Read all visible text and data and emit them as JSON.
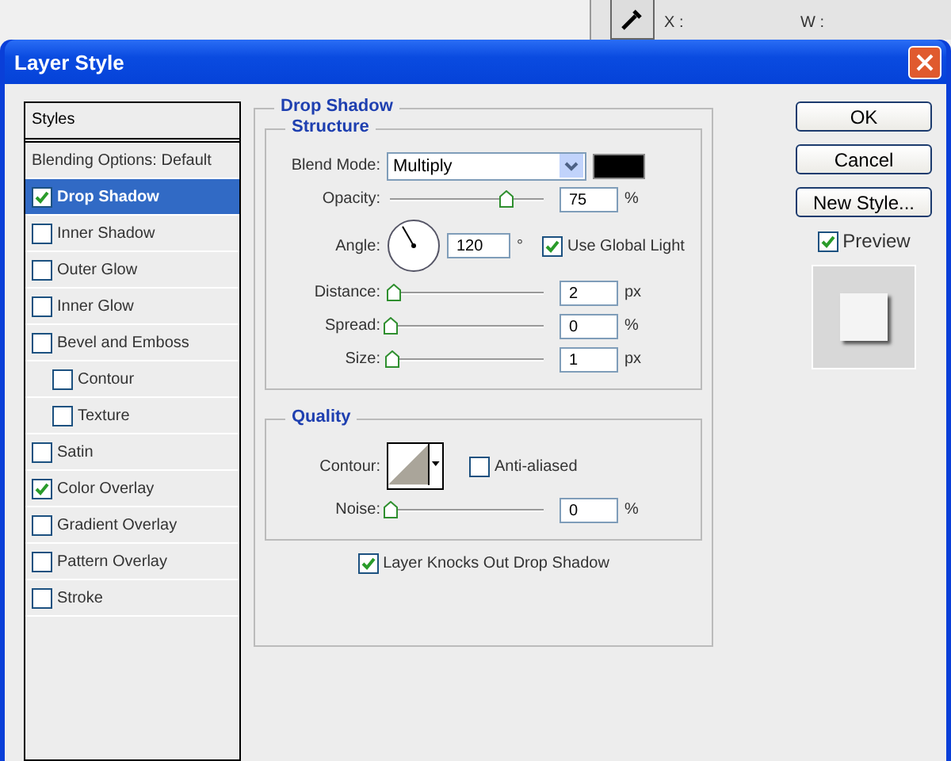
{
  "background": {
    "labels": [
      "X :",
      "W :"
    ]
  },
  "window": {
    "title": "Layer Style"
  },
  "styles_panel": {
    "header": "Styles",
    "items": [
      {
        "label": "Blending Options: Default",
        "kind": "plain",
        "selected": false
      },
      {
        "label": "Drop Shadow",
        "kind": "check",
        "checked": true,
        "selected": true
      },
      {
        "label": "Inner Shadow",
        "kind": "check",
        "checked": false,
        "selected": false
      },
      {
        "label": "Outer Glow",
        "kind": "check",
        "checked": false,
        "selected": false
      },
      {
        "label": "Inner Glow",
        "kind": "check",
        "checked": false,
        "selected": false
      },
      {
        "label": "Bevel and Emboss",
        "kind": "check",
        "checked": false,
        "selected": false,
        "children": [
          {
            "label": "Contour",
            "kind": "check",
            "checked": false,
            "selected": false
          },
          {
            "label": "Texture",
            "kind": "check",
            "checked": false,
            "selected": false
          }
        ]
      },
      {
        "label": "Satin",
        "kind": "check",
        "checked": false,
        "selected": false
      },
      {
        "label": "Color Overlay",
        "kind": "check",
        "checked": true,
        "selected": false
      },
      {
        "label": "Gradient Overlay",
        "kind": "check",
        "checked": false,
        "selected": false
      },
      {
        "label": "Pattern Overlay",
        "kind": "check",
        "checked": false,
        "selected": false
      },
      {
        "label": "Stroke",
        "kind": "check",
        "checked": false,
        "selected": false
      }
    ]
  },
  "drop_shadow": {
    "title": "Drop Shadow",
    "structure": {
      "title": "Structure",
      "blend_mode": {
        "label": "Blend Mode:",
        "value": "Multiply"
      },
      "rows": [
        {
          "kind": "slider",
          "label": "Opacity:",
          "value": "75",
          "unit": "%",
          "level": 0.75
        },
        {
          "kind": "angle",
          "label": "Angle:",
          "value": "120",
          "unit": "°",
          "global_light": {
            "label": "Use Global Light",
            "checked": true
          }
        },
        {
          "kind": "slider",
          "label": "Distance:",
          "value": "2",
          "unit": "px",
          "level": 0.02
        },
        {
          "kind": "slider",
          "label": "Spread:",
          "value": "0",
          "unit": "%",
          "level": 0
        },
        {
          "kind": "slider",
          "label": "Size:",
          "value": "1",
          "unit": "px",
          "level": 0.01
        }
      ]
    },
    "quality": {
      "title": "Quality",
      "contour_label": "Contour:",
      "anti_aliased": {
        "label": "Anti-aliased",
        "checked": false
      },
      "noise": {
        "label": "Noise:",
        "value": "0",
        "unit": "%",
        "level": 0
      }
    },
    "knockout": {
      "label": "Layer Knocks Out Drop Shadow",
      "checked": true
    }
  },
  "buttons": [
    "OK",
    "Cancel",
    "New Style..."
  ],
  "preview": {
    "label": "Preview",
    "checked": true
  }
}
